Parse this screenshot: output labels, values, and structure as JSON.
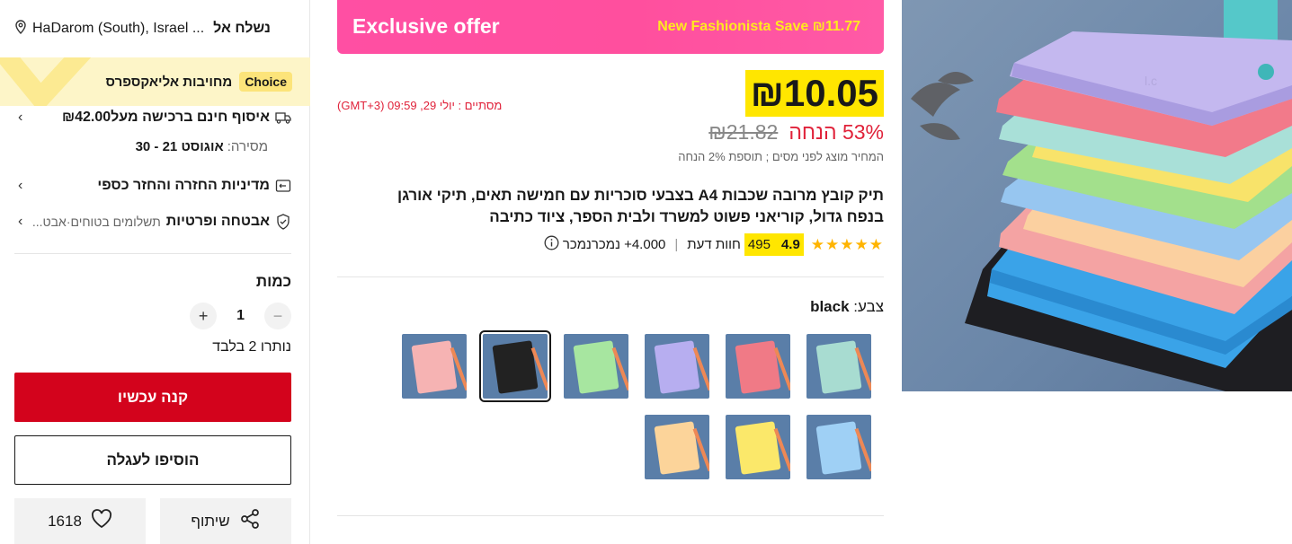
{
  "shipping": {
    "label": "נשלח אל",
    "location": "HaDarom (South), Israel ..."
  },
  "choice": {
    "tag": "Choice",
    "text": "מחויבות אליאקספרס"
  },
  "delivery": {
    "title": "איסוף חינם ברכישה מעל₪42.00",
    "date_label": "מסירה:",
    "date_value": "אוגוסט 21 - 30"
  },
  "returns": {
    "title": "מדיניות החזרה והחזר כספי"
  },
  "security": {
    "title": "אבטחה ופרטיות",
    "detail": "תשלומים בטוחים·אבט..."
  },
  "quantity": {
    "title": "כמות",
    "value": "1",
    "minus": "−",
    "plus": "+",
    "remaining": "נותרו 2 בלבד"
  },
  "buttons": {
    "buy_now": "קנה עכשיו",
    "add_to_cart": "הוסיפו לעגלה",
    "share": "שיתוף",
    "wishlist_count": "1618"
  },
  "offer": {
    "title": "Exclusive offer",
    "promo": "New Fashionista Save ₪11.77"
  },
  "price": {
    "current": "₪10.05",
    "timer": "מסתיים : יולי 29, 09:59 (GMT+3)",
    "original": "₪21.82",
    "discount": "53% הנחה",
    "tax_note": "המחיר מוצג לפני מסים ; תוספת 2% הנחה"
  },
  "product": {
    "title": "תיק קובץ מרובה שכבות A4 בצבעי סוכריות עם חמישה תאים, תיקי אורגן בנפח גדול, קוריאני פשוט למשרד ולבית הספר, ציוד כתיבה",
    "rating": "4.9",
    "reviews_count": "495",
    "reviews_label": "חוות דעת",
    "separator": "|",
    "sold": "4.000+ נמכרנמכר",
    "stars": "★★★★★"
  },
  "color": {
    "label": "צבע:",
    "selected": "black"
  },
  "swatches": [
    {
      "color": "#a8dcd1"
    },
    {
      "color": "#f07a86"
    },
    {
      "color": "#b7aef0"
    },
    {
      "color": "#a7e6a0"
    },
    {
      "color": "#222222"
    },
    {
      "color": "#f6b3b3"
    },
    {
      "color": "#9fd0f5"
    },
    {
      "color": "#fbe86a"
    },
    {
      "color": "#fcd49a"
    }
  ],
  "colors": {
    "accent_red": "#d3031c",
    "highlight": "#ffe600",
    "offer_pink": "#ff4fa3"
  }
}
